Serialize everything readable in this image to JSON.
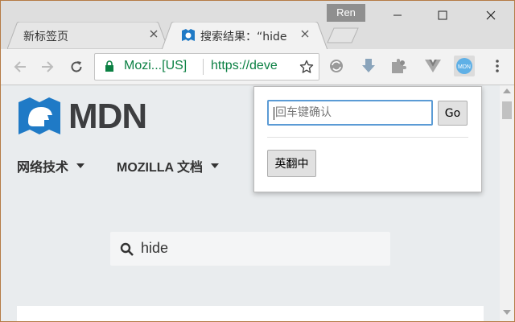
{
  "browser": {
    "profile_name": "Ren",
    "tabs": [
      {
        "title": "新标签页",
        "active": false
      },
      {
        "title": "搜索结果：“hide",
        "active": true
      }
    ],
    "omnibox": {
      "secure_label": "Mozi...[US]",
      "url": "https://deve"
    },
    "extensions": [
      "sync-icon",
      "download-arrow-icon",
      "puzzle-icon",
      "vue-icon",
      "mdn-translate-icon"
    ]
  },
  "page": {
    "logo_text": "MDN",
    "nav": [
      {
        "label": "网络技术"
      },
      {
        "label": "MOZILLA 文档"
      }
    ],
    "search": {
      "value": "hide"
    }
  },
  "popup": {
    "input_placeholder": "回车键确认",
    "go_label": "Go",
    "translate_label": "英翻中"
  },
  "colors": {
    "secure_green": "#0b8043",
    "mdn_blue": "#1f7ac6",
    "page_bg": "#e9ecee",
    "popup_input_border": "#5b9bd5"
  }
}
